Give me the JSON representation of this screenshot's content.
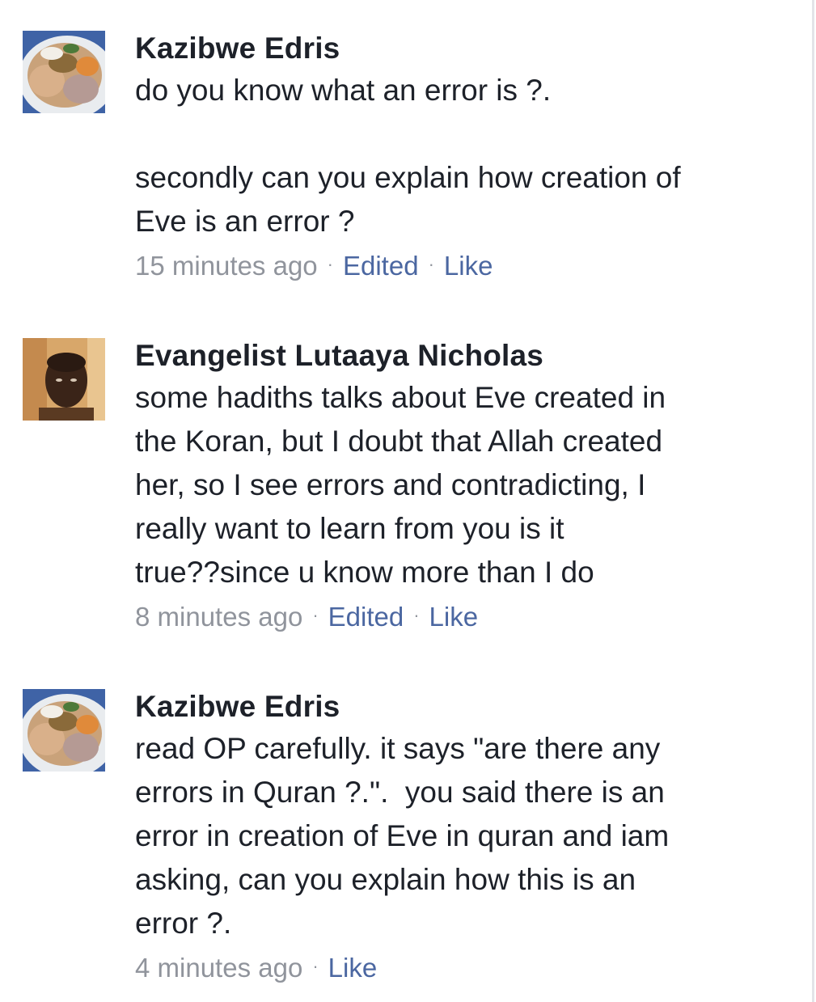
{
  "comments": [
    {
      "author": "Kazibwe Edris",
      "text": "do you know what an error is ?.\n\nsecondly can you explain how creation of\nEve is an error ?",
      "time": "15 minutes ago",
      "edited": "Edited",
      "like": "Like",
      "avatar_icon": "food-plate-avatar"
    },
    {
      "author": "Evangelist Lutaaya Nicholas",
      "text": "some hadiths talks about Eve created in\nthe Koran, but I doubt that Allah created\nher, so I see errors and contradicting, I\nreally want to learn from you is it\ntrue??since u know more than I do",
      "time": "8 minutes ago",
      "edited": "Edited",
      "like": "Like",
      "avatar_icon": "person-portrait-avatar"
    },
    {
      "author": "Kazibwe Edris",
      "text": "read OP carefully. it says \"are there any\nerrors in Quran ?.\".  you said there is an\nerror in creation of Eve in quran and iam\nasking, can you explain how this is an\nerror ?.",
      "time": "4 minutes ago",
      "like": "Like",
      "avatar_icon": "food-plate-avatar"
    }
  ],
  "separator": "·",
  "colors": {
    "author": "#1d2129",
    "meta": "#90949c",
    "link": "#4b67a1"
  }
}
